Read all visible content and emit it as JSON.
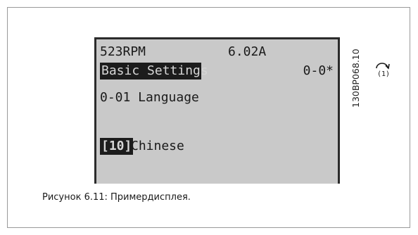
{
  "display": {
    "status_speed": "523RPM",
    "status_current": "6.02A",
    "setup_indicator": "(1)",
    "group_title": "Basic Settings",
    "group_code": "0-0*",
    "parameter": "0-01 Language",
    "selected_value_code": "[10]",
    "selected_value_label": "Chinese"
  },
  "doc_code": "130BP068.10",
  "caption": "Рисунок 6.11: Примердисплея."
}
